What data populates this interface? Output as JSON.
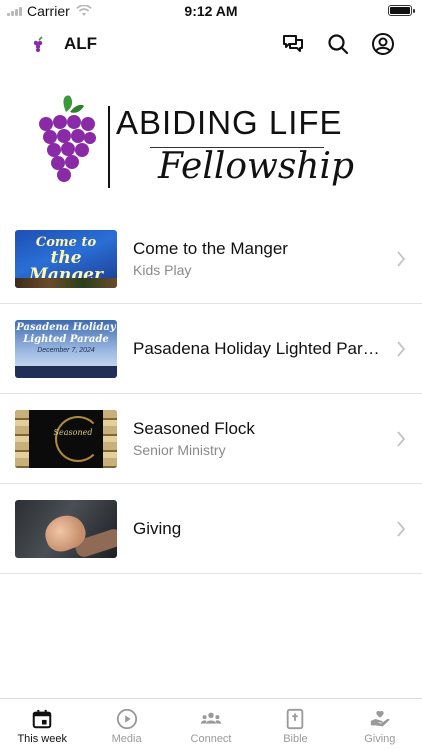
{
  "status_bar": {
    "carrier": "Carrier",
    "time": "9:12 AM",
    "battery_level": 1.0
  },
  "header": {
    "title": "ALF",
    "icons": [
      "chat-icon",
      "search-icon",
      "account-icon"
    ]
  },
  "brand": {
    "name": "ABIDING LIFE",
    "subtitle": "Fellowship"
  },
  "items": [
    {
      "title": "Come to the Manger",
      "subtitle": "Kids Play",
      "thumbnail_text": [
        "Come to",
        "the Manger"
      ]
    },
    {
      "title": "Pasadena Holiday Lighted Para...",
      "subtitle": "",
      "thumbnail_text": [
        "Pasadena Holiday",
        "Lighted Parade",
        "December 7, 2024"
      ]
    },
    {
      "title": "Seasoned Flock",
      "subtitle": "Senior Ministry",
      "thumbnail_text": [
        "Seasoned"
      ]
    },
    {
      "title": "Giving",
      "subtitle": ""
    }
  ],
  "tabs": [
    {
      "label": "This week",
      "icon": "calendar-icon",
      "active": true
    },
    {
      "label": "Media",
      "icon": "play-circle-icon",
      "active": false
    },
    {
      "label": "Connect",
      "icon": "group-icon",
      "active": false
    },
    {
      "label": "Bible",
      "icon": "bible-icon",
      "active": false
    },
    {
      "label": "Giving",
      "icon": "giving-hand-icon",
      "active": false
    }
  ],
  "colors": {
    "grape_purple": "#8a2aa6",
    "leaf_green": "#3a9a3a",
    "active_tab": "#111111",
    "inactive_tab": "#9a9a9a"
  }
}
